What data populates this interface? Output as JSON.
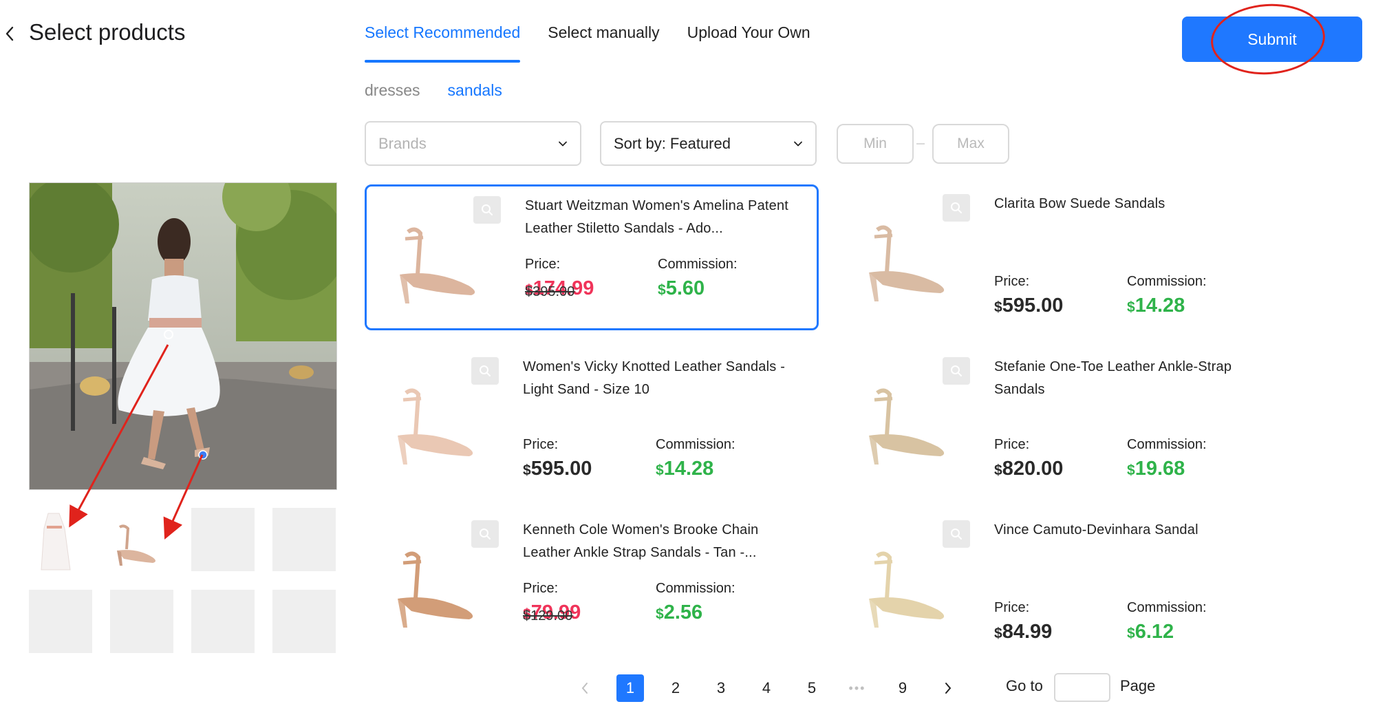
{
  "header": {
    "title": "Select products",
    "submit_label": "Submit"
  },
  "tabs": [
    {
      "label": "Select Recommended",
      "active": true
    },
    {
      "label": "Select manually",
      "active": false
    },
    {
      "label": "Upload Your Own",
      "active": false
    }
  ],
  "subcategories": [
    {
      "label": "dresses",
      "active": false
    },
    {
      "label": "sandals",
      "active": true
    }
  ],
  "filters": {
    "brands_placeholder": "Brands",
    "sort_value": "Sort by: Featured",
    "min_placeholder": "Min",
    "max_placeholder": "Max"
  },
  "labels": {
    "price": "Price:",
    "commission": "Commission:"
  },
  "currency": "$",
  "products": [
    {
      "name": "Stuart Weitzman Women's Amelina Patent Leather Stiletto Sandals - Ado...",
      "price": "174.99",
      "original_price": "$395.00",
      "commission": "5.60",
      "on_sale": true,
      "selected": true
    },
    {
      "name": "Clarita Bow Suede Sandals",
      "price": "595.00",
      "commission": "14.28",
      "on_sale": false,
      "selected": false
    },
    {
      "name": "Women's Vicky Knotted Leather Sandals - Light Sand - Size 10",
      "price": "595.00",
      "commission": "14.28",
      "on_sale": false,
      "selected": false
    },
    {
      "name": "Stefanie One-Toe Leather Ankle-Strap Sandals",
      "price": "820.00",
      "commission": "19.68",
      "on_sale": false,
      "selected": false
    },
    {
      "name": "Kenneth Cole Women's Brooke Chain Leather Ankle Strap Sandals - Tan -...",
      "price": "79.99",
      "original_price": "$129.00",
      "commission": "2.56",
      "on_sale": true,
      "selected": false
    },
    {
      "name": "Vince Camuto-Devinhara Sandal",
      "price": "84.99",
      "commission": "6.12",
      "on_sale": false,
      "selected": false
    }
  ],
  "pagination": {
    "pages": [
      "1",
      "2",
      "3",
      "4",
      "5",
      "9"
    ],
    "current": "1",
    "ellipsis": "•••",
    "goto_label": "Go to",
    "page_label": "Page"
  },
  "colors": {
    "accent": "#1f78ff",
    "sale_price": "#f0345a",
    "commission": "#2fb34a",
    "annotation": "#e0231c"
  },
  "icons": [
    "back-chevron-icon",
    "chevron-down-icon",
    "zoom-icon",
    "pagination-prev-icon",
    "pagination-next-icon"
  ]
}
